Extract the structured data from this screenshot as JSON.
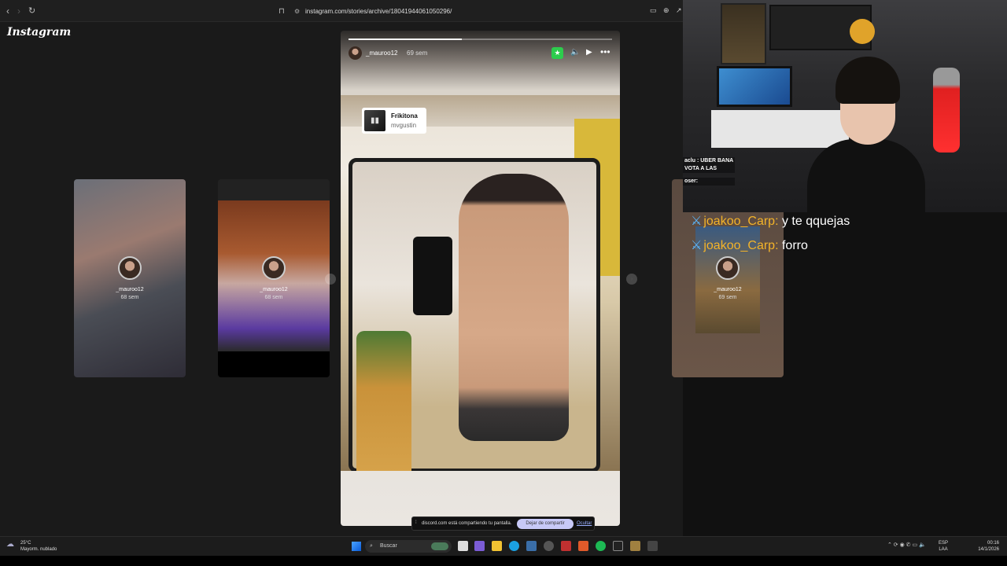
{
  "browser": {
    "url": "instagram.com/stories/archive/18041944061050296/"
  },
  "instagram": {
    "logo": "Instagram",
    "side_stories": [
      {
        "user": "_mauroo12",
        "age": "68 sem"
      },
      {
        "user": "_mauroo12",
        "age": "68 sem"
      },
      {
        "user": "_mauroo12",
        "age": "69 sem"
      }
    ],
    "main_story": {
      "user": "_mauroo12",
      "age": "69 sem",
      "progress": 0.43,
      "music_title": "Frikitona",
      "music_artist": "mvgustin"
    }
  },
  "share_bar": {
    "text": "discord.com está compartiendo tu pantalla.",
    "stop_label": "Dejar de compartir",
    "hide_label": "Ocultar"
  },
  "stream_overlay": {
    "lines": [
      "aclu : UBER BANA",
      "VOTA A LAS",
      "oser:"
    ]
  },
  "chat": [
    {
      "user": "joakoo_Carp",
      "message": "y te qquejas"
    },
    {
      "user": "joakoo_Carp",
      "message": "forro"
    }
  ],
  "taskbar": {
    "temp": "25°C",
    "weather": "Mayorm. nublado",
    "search": "Buscar",
    "lang_top": "ESP",
    "lang_bottom": "LAA",
    "time": "00:16",
    "date": "14/1/2026"
  },
  "colors": {
    "accent_chat_user": "#f3b329",
    "chat_icon": "#5bb8ff",
    "close_friends_star": "#2dcc4d",
    "share_stop_button": "#c7c9f7"
  }
}
